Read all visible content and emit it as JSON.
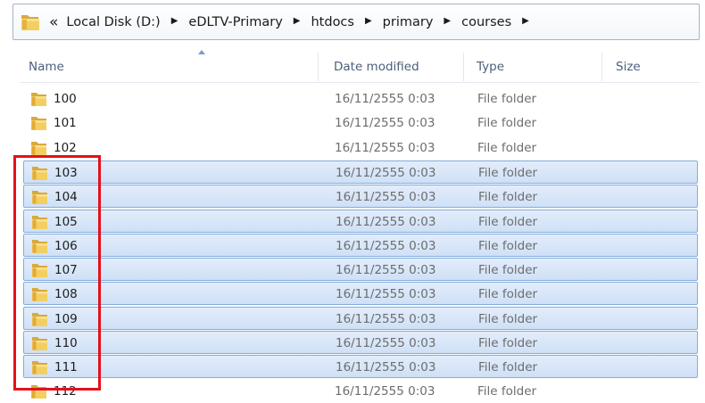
{
  "address_bar": {
    "overflow_chevron": "«",
    "separator_glyph": "▶",
    "folder_icon": "folder-icon",
    "crumbs": [
      "Local Disk (D:)",
      "eDLTV-Primary",
      "htdocs",
      "primary",
      "courses"
    ]
  },
  "list": {
    "columns": {
      "name": "Name",
      "date_modified": "Date modified",
      "type": "Type",
      "size": "Size"
    },
    "sort_column": "Name",
    "rows": [
      {
        "name": "100",
        "date": "16/11/2555 0:03",
        "type": "File folder",
        "selected": false
      },
      {
        "name": "101",
        "date": "16/11/2555 0:03",
        "type": "File folder",
        "selected": false
      },
      {
        "name": "102",
        "date": "16/11/2555 0:03",
        "type": "File folder",
        "selected": false
      },
      {
        "name": "103",
        "date": "16/11/2555 0:03",
        "type": "File folder",
        "selected": true
      },
      {
        "name": "104",
        "date": "16/11/2555 0:03",
        "type": "File folder",
        "selected": true
      },
      {
        "name": "105",
        "date": "16/11/2555 0:03",
        "type": "File folder",
        "selected": true
      },
      {
        "name": "106",
        "date": "16/11/2555 0:03",
        "type": "File folder",
        "selected": true
      },
      {
        "name": "107",
        "date": "16/11/2555 0:03",
        "type": "File folder",
        "selected": true
      },
      {
        "name": "108",
        "date": "16/11/2555 0:03",
        "type": "File folder",
        "selected": true
      },
      {
        "name": "109",
        "date": "16/11/2555 0:03",
        "type": "File folder",
        "selected": true
      },
      {
        "name": "110",
        "date": "16/11/2555 0:03",
        "type": "File folder",
        "selected": true
      },
      {
        "name": "111",
        "date": "16/11/2555 0:03",
        "type": "File folder",
        "selected": true
      },
      {
        "name": "112",
        "date": "16/11/2555 0:03",
        "type": "File folder",
        "selected": false
      }
    ]
  },
  "colors": {
    "selection_fill": "#d6e5f7",
    "selection_border": "#84acdd",
    "highlight_box": "#e4111b",
    "header_text": "#4c607a"
  }
}
